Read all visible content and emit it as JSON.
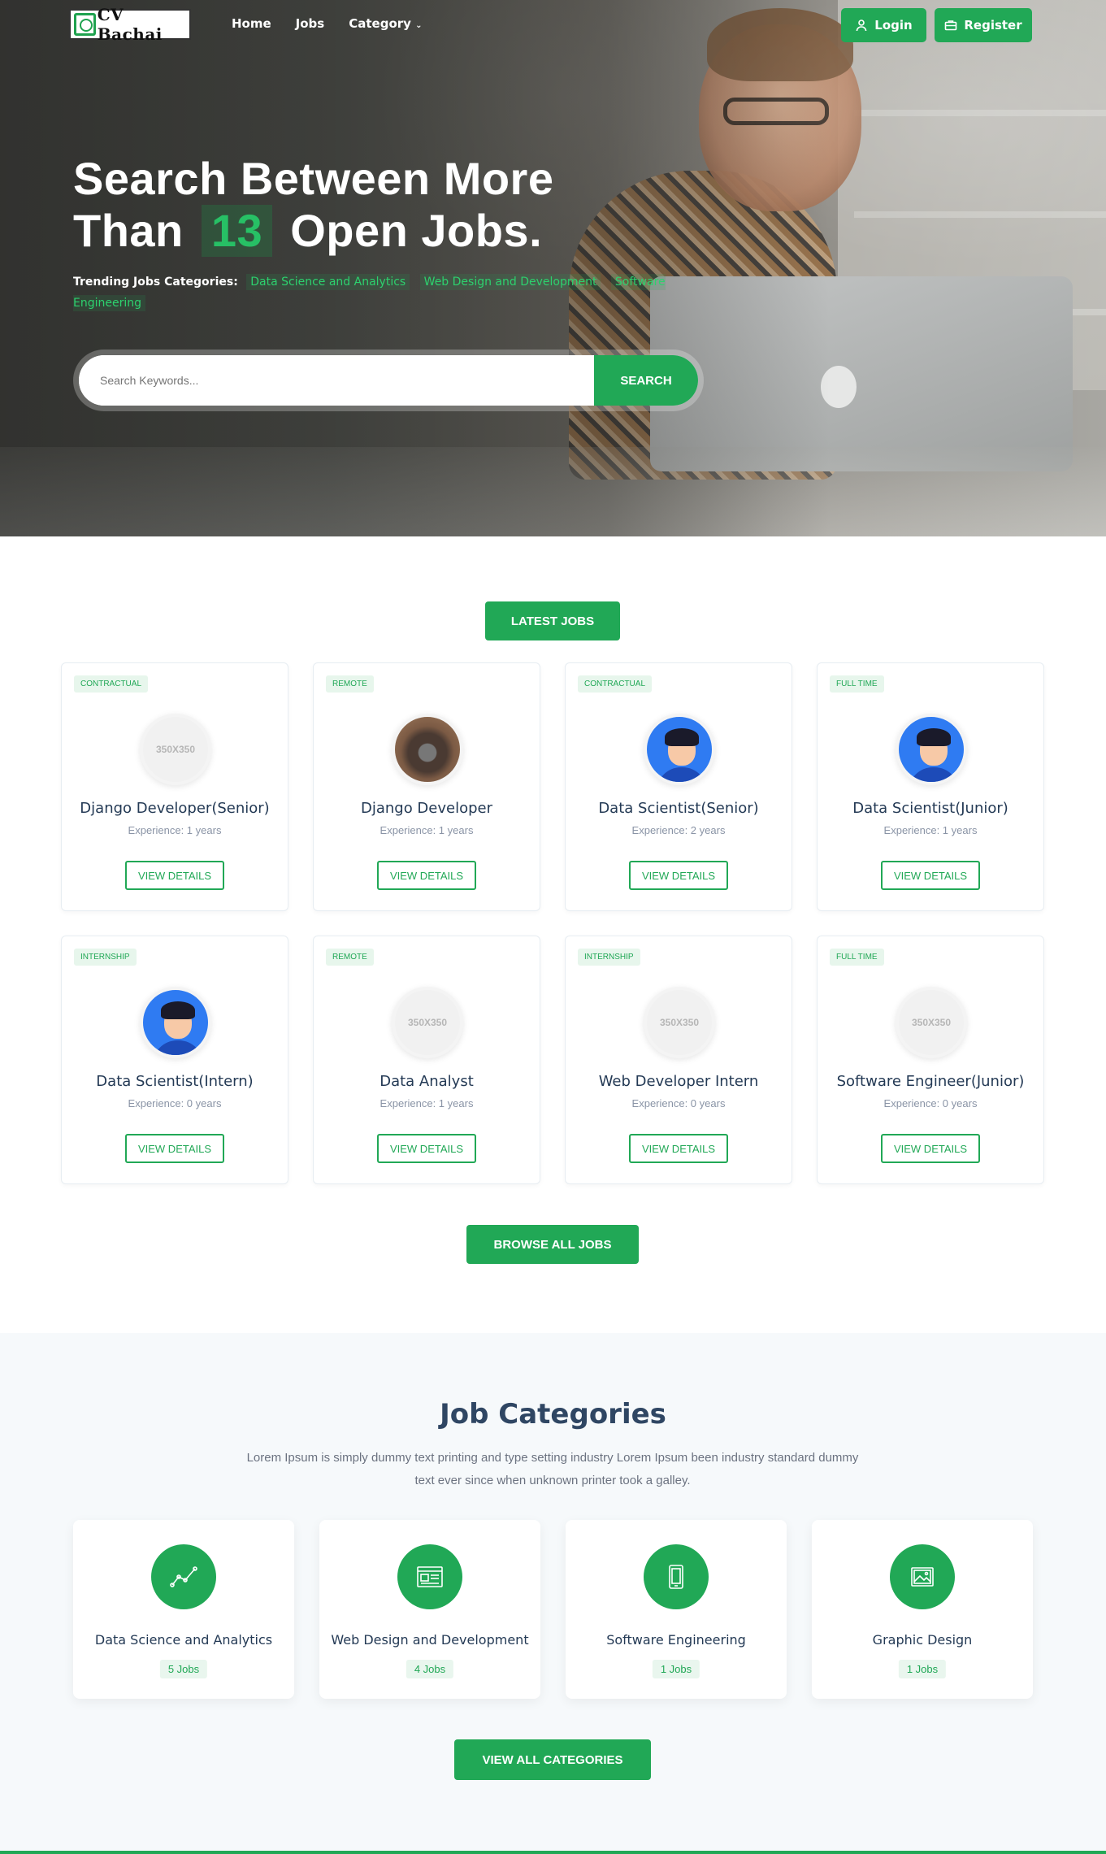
{
  "nav": {
    "logo_text": "CV Bachai",
    "menu": [
      "Home",
      "Jobs",
      "Category"
    ],
    "login": "Login",
    "register": "Register"
  },
  "hero": {
    "title_line1": "Search Between More",
    "title_prefix": "Than",
    "count": "13",
    "title_suffix": "Open Jobs.",
    "trending_label": "Trending Jobs Categories:",
    "trending": [
      "Data Science and Analytics",
      "Web Design and Development",
      "Software Engineering"
    ],
    "search_placeholder": "Search Keywords...",
    "search_button": "SEARCH"
  },
  "latest": {
    "button": "LATEST JOBS",
    "view_label": "VIEW DETAILS",
    "browse": "BROWSE ALL JOBS",
    "jobs": [
      {
        "type": "CONTRACTUAL",
        "title": "Django Developer(Senior)",
        "experience": "Experience: 1 years",
        "avatar": "placeholder"
      },
      {
        "type": "REMOTE",
        "title": "Django Developer",
        "experience": "Experience: 1 years",
        "avatar": "photo"
      },
      {
        "type": "CONTRACTUAL",
        "title": "Data Scientist(Senior)",
        "experience": "Experience: 2 years",
        "avatar": "user"
      },
      {
        "type": "FULL TIME",
        "title": "Data Scientist(Junior)",
        "experience": "Experience: 1 years",
        "avatar": "user"
      },
      {
        "type": "INTERNSHIP",
        "title": "Data Scientist(Intern)",
        "experience": "Experience: 0 years",
        "avatar": "user"
      },
      {
        "type": "REMOTE",
        "title": "Data Analyst",
        "experience": "Experience: 1 years",
        "avatar": "placeholder"
      },
      {
        "type": "INTERNSHIP",
        "title": "Web Developer Intern",
        "experience": "Experience: 0 years",
        "avatar": "placeholder"
      },
      {
        "type": "FULL TIME",
        "title": "Software Engineer(Junior)",
        "experience": "Experience: 0 years",
        "avatar": "placeholder"
      }
    ],
    "placeholder_text": "350X350"
  },
  "categories": {
    "title": "Job Categories",
    "description": "Lorem Ipsum is simply dummy text printing and type setting industry Lorem Ipsum been industry standard dummy text ever since when unknown printer took a galley.",
    "items": [
      {
        "name": "Data Science and Analytics",
        "count": "5 Jobs",
        "icon": "chart-line-icon"
      },
      {
        "name": "Web Design and Development",
        "count": "4 Jobs",
        "icon": "browser-window-icon"
      },
      {
        "name": "Software Engineering",
        "count": "1 Jobs",
        "icon": "mobile-device-icon"
      },
      {
        "name": "Graphic Design",
        "count": "1 Jobs",
        "icon": "image-icon"
      }
    ],
    "view_all": "VIEW ALL CATEGORIES"
  },
  "colors": {
    "accent": "#21a856",
    "heading": "#2f4663"
  }
}
